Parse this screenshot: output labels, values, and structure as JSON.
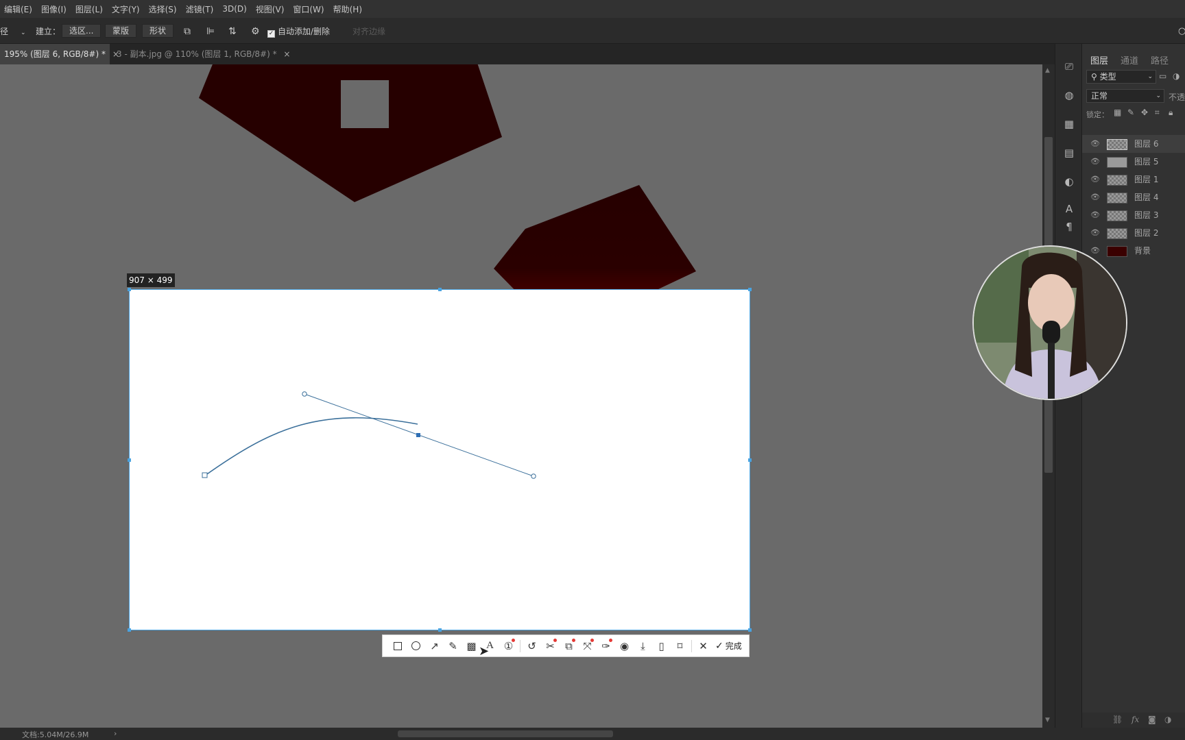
{
  "menu": [
    "编辑(E)",
    "图像(I)",
    "图层(L)",
    "文字(Y)",
    "选择(S)",
    "滤镜(T)",
    "3D(D)",
    "视图(V)",
    "窗口(W)",
    "帮助(H)"
  ],
  "options": {
    "tool_partial": "径",
    "make_label": "建立：",
    "selection_btn": "选区...",
    "mask_btn": "蒙版",
    "shape_btn": "形状",
    "auto_add_delete": "自动添加/删除",
    "align_edges": "对齐边缘"
  },
  "tabs": [
    {
      "label": "195% (图层 6, RGB/8#) *",
      "close": "×"
    },
    {
      "label": "3 - 副本.jpg @ 110% (图层 1, RGB/8#) *",
      "close": "×"
    }
  ],
  "layers_panel": {
    "tabs": [
      "图层",
      "通道",
      "路径"
    ],
    "filter_label": "类型",
    "blend_mode": "正常",
    "opacity_label": "不透",
    "lock_label": "锁定：",
    "layers": [
      {
        "name": "图层 6",
        "thumb": "checker",
        "selected": true
      },
      {
        "name": "图层 5",
        "thumb": "gray",
        "selected": false
      },
      {
        "name": "图层 1",
        "thumb": "checker",
        "selected": false
      },
      {
        "name": "图层 4",
        "thumb": "checker",
        "selected": false
      },
      {
        "name": "图层 3",
        "thumb": "checker",
        "selected": false
      },
      {
        "name": "图层 2",
        "thumb": "checker",
        "selected": false
      },
      {
        "name": "背景",
        "thumb": "darkred",
        "selected": false
      }
    ],
    "fx_label": "fx"
  },
  "screenshot_overlay": {
    "size_label": "907 × 499",
    "done_label": "完成",
    "tools": [
      "rectangle-icon",
      "ellipse-icon",
      "arrow-icon",
      "pencil-icon",
      "mosaic-icon",
      "text-icon",
      "number-icon",
      "undo-icon",
      "cutout-icon",
      "translate-icon",
      "resize-icon",
      "pin-icon",
      "record-icon",
      "download-icon",
      "phone-icon",
      "bookmark-icon",
      "close-icon",
      "check-icon"
    ]
  },
  "status": {
    "doc_info": "文档:5.04M/26.9M"
  },
  "colors": {
    "shape_dark": "#260000",
    "shape_red": "#6b0000",
    "selection_blue": "#4aa3e0",
    "path_line": "#3a6f9a"
  }
}
